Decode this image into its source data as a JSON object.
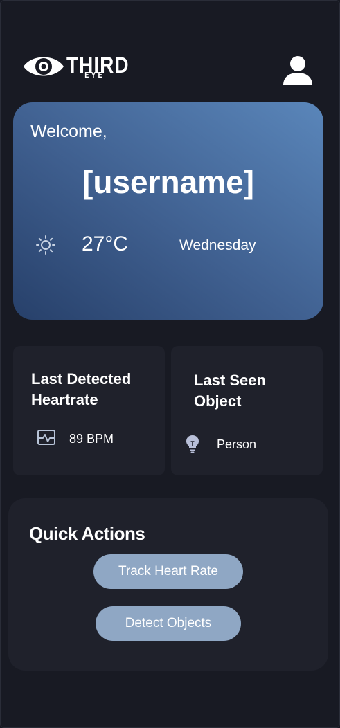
{
  "header": {
    "brand_main": "THIRD",
    "brand_sub": "EYE",
    "logo_icon": "eye-logo-icon",
    "profile_icon": "user-icon"
  },
  "welcome": {
    "greeting": "Welcome,",
    "username": "[username]",
    "weather_icon": "sun-icon",
    "temperature": "27°C",
    "day": "Wednesday"
  },
  "heartrate_card": {
    "title_line1": "Last Detected",
    "title_line2": "Heartrate",
    "icon": "heart-monitor-icon",
    "value": "89 BPM"
  },
  "object_card": {
    "title_line1": "Last Seen",
    "title_line2": "Object",
    "icon": "lightbulb-icon",
    "value": "Person"
  },
  "quick_actions": {
    "title": "Quick Actions",
    "track_label": "Track Heart Rate",
    "detect_label": "Detect Objects"
  },
  "colors": {
    "background": "#181a23",
    "card": "#1f212b",
    "button": "#8fa7c4",
    "gradient_start": "#27406a",
    "gradient_end": "#5a86ba"
  }
}
